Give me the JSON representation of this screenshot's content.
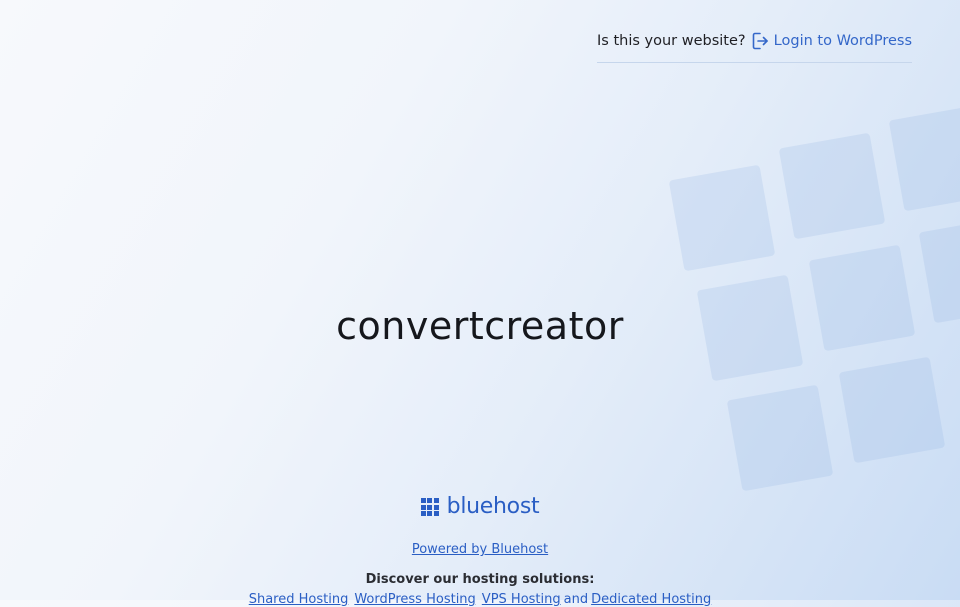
{
  "header": {
    "question": "Is this your website?",
    "login_label": "Login to WordPress"
  },
  "main": {
    "site_title": "convertcreator"
  },
  "footer": {
    "brand_name": "bluehost",
    "powered_by": "Powered by Bluehost",
    "discover_heading": "Discover our hosting solutions:",
    "solutions": [
      "Shared Hosting",
      "WordPress Hosting",
      "VPS Hosting",
      "Dedicated Hosting"
    ],
    "solutions_conjunction": "and"
  },
  "colors": {
    "brand_blue": "#2a5ec4",
    "link_blue": "#3467c9",
    "title_text": "#15171c"
  }
}
